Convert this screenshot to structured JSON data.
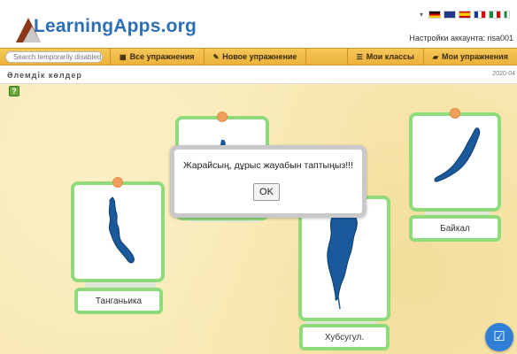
{
  "header": {
    "logo_text": "LearningApps.org",
    "account_label": "Настройки аккаунта: risa001"
  },
  "nav": {
    "search_placeholder": "Search temporarily disabled",
    "items": [
      {
        "icon": "grid-icon",
        "label": "Все упражнения"
      },
      {
        "icon": "pencil-icon",
        "label": "Новое упражнение"
      },
      {
        "icon": "list-icon",
        "label": "Мои классы"
      },
      {
        "icon": "folder-icon",
        "label": "Мои упражнения"
      }
    ]
  },
  "page": {
    "title": "Әлемдік көлдер",
    "date": "2020-04"
  },
  "cards": [
    {
      "name": "Танганьика"
    },
    {
      "name": "Хубсугул."
    },
    {
      "name": "Байкал"
    }
  ],
  "dialog": {
    "message": "Жарайсың, дұрыс жауабын таптыңыз!!!",
    "ok_label": "OK"
  },
  "colors": {
    "card_border": "#8fda7a",
    "pin": "#f0a05c",
    "lake": "#1a5a9c",
    "nav": "#eab23a",
    "check_button": "#2f7fd6"
  }
}
